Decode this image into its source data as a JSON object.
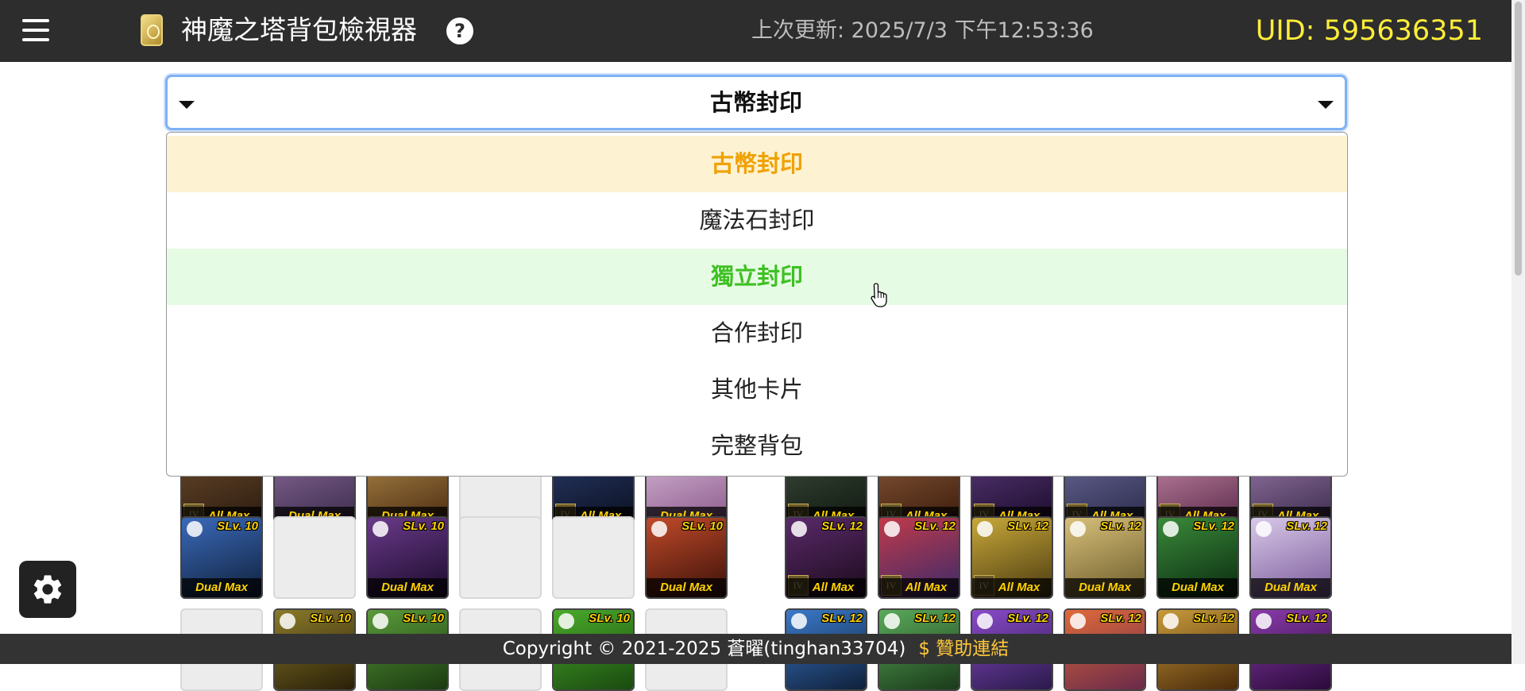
{
  "header": {
    "title": "神魔之塔背包檢視器",
    "last_update": "上次更新: 2025/7/3 下午12:53:36",
    "uid": "UID: 595636351",
    "help_glyph": "?"
  },
  "select": {
    "value": "古幣封印",
    "options": [
      "古幣封印",
      "魔法石封印",
      "獨立封印",
      "合作封印",
      "其他卡片",
      "完整背包"
    ],
    "selected_index": 0,
    "hover_index": 2
  },
  "cards": {
    "slv10": "SLv. 10",
    "slv12": "SLv. 12",
    "all_max": "All Max",
    "dual_max": "Dual Max",
    "rank": "IV"
  },
  "footer": {
    "copyright": "Copyright © 2021-2025 蒼曜(tinghan33704)",
    "sponsor": "$ 贊助連結"
  },
  "colors": {
    "navbar": "#2d2d2d",
    "uid": "#ffee3a",
    "selected_option": "#f0a100",
    "hover_option": "#3ec024",
    "sponsor": "#ffc83a"
  }
}
